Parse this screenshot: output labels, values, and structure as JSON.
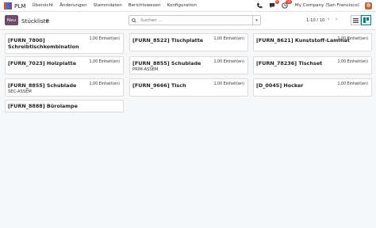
{
  "navbar": {
    "app_name": "PLM",
    "menu": [
      "Übersicht",
      "Änderungen",
      "Stammdaten",
      "Berichtswesen",
      "Konfiguration"
    ],
    "messages_badge": "4",
    "activity_badge": "17",
    "company": "My Company (San Francisco)"
  },
  "control": {
    "new_label": "Neu",
    "breadcrumb": "Stückliste",
    "search_placeholder": "Suchen ...",
    "pager": "1-10 / 10"
  },
  "cards": [
    {
      "title": "[FURN_7800]",
      "title2": "Schreibtischkombination",
      "qty": "1,00 Einheit(en)",
      "sub": ""
    },
    {
      "title": "[FURN_8522] Tischplatte",
      "title2": "",
      "qty": "1,00 Einheit(en)",
      "sub": ""
    },
    {
      "title": "[FURN_8621] Kunststoff-Laminat",
      "title2": "",
      "qty": "1,00 Einheit(en)",
      "sub": ""
    },
    {
      "title": "[FURN_7023] Holzplatte",
      "title2": "",
      "qty": "1,00 Einheit(en)",
      "sub": ""
    },
    {
      "title": "[FURN_8855] Schublade",
      "title2": "",
      "qty": "1,00 Einheit(en)",
      "sub": "PRIM-ASSEM"
    },
    {
      "title": "[FURN_78236] Tischset",
      "title2": "",
      "qty": "1,00 Einheit(en)",
      "sub": ""
    },
    {
      "title": "[FURN_8855] Schublade",
      "title2": "",
      "qty": "1,00 Einheit(en)",
      "sub": "SEC-ASSEM"
    },
    {
      "title": "[FURN_9666] Tisch",
      "title2": "",
      "qty": "1,00 Einheit(en)",
      "sub": ""
    },
    {
      "title": "[D_0045] Hocker",
      "title2": "",
      "qty": "1,00 Einheit(en)",
      "sub": ""
    },
    {
      "title": "[FURN_8888] Bürolampe",
      "title2": "",
      "qty": "",
      "sub": ""
    }
  ],
  "colors": {
    "brand": "#714b67",
    "accent": "#017e84",
    "badge": "#e8453c"
  }
}
